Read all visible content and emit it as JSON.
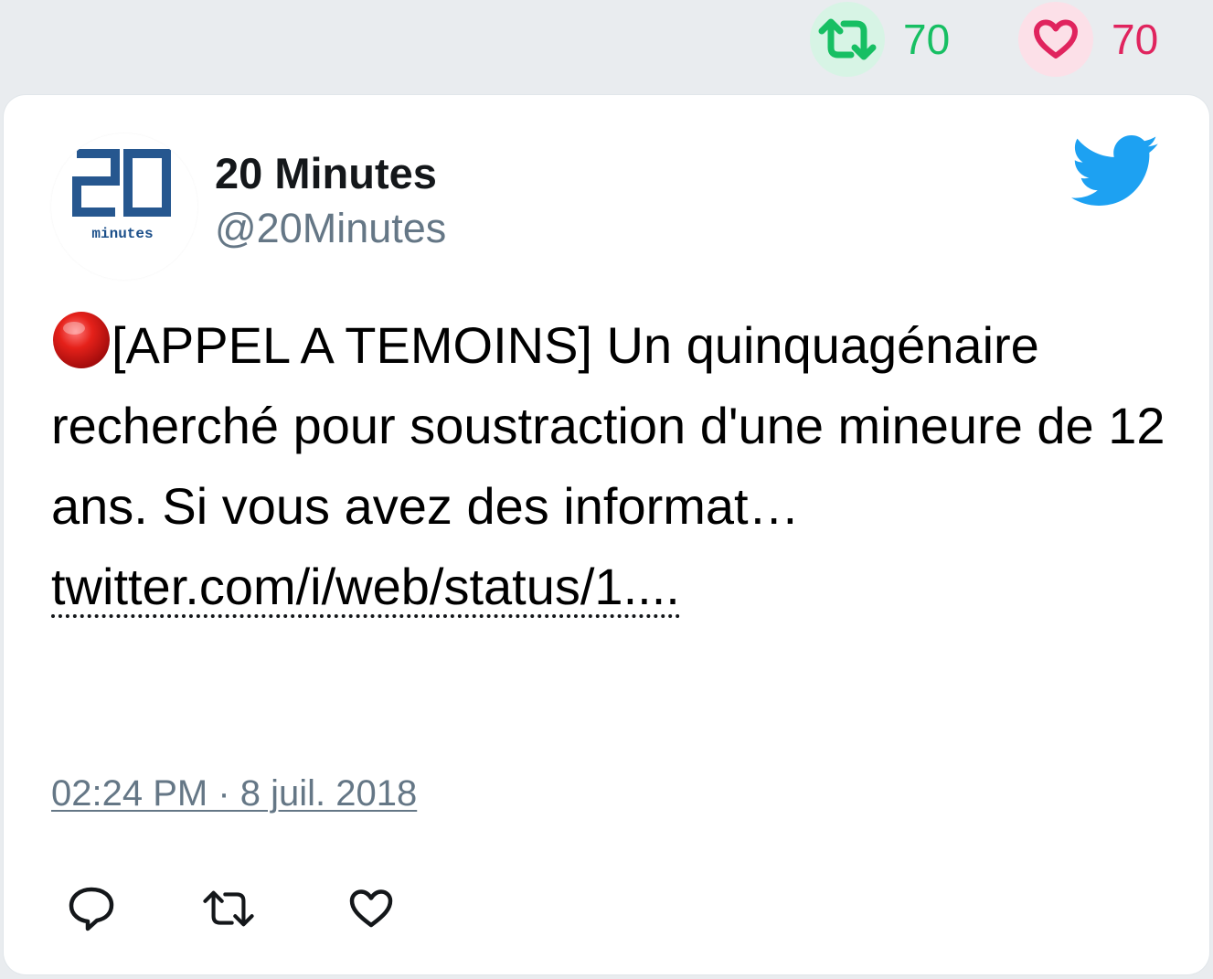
{
  "stats": {
    "retweet_count": "70",
    "like_count": "70",
    "retweet_color": "#17bf63",
    "like_color": "#e0245e",
    "retweet_icon": "retweet-icon",
    "like_icon": "heart-icon"
  },
  "tweet": {
    "author_name": "20 Minutes",
    "author_handle": "@20Minutes",
    "avatar_logo": {
      "digits": "20",
      "caption": "minutes",
      "color": "#1b4f8a"
    },
    "status_emoji": "red-circle",
    "text": "[APPEL A TEMOINS] Un quinquagénaire recherché pour soustraction d'une mineure de 12 ans. Si vous avez des informat…",
    "link": "twitter.com/i/web/status/1....",
    "timestamp": "02:24 PM · 8 juil. 2018",
    "brand_icon": "twitter-bird-icon",
    "brand_color": "#1da1f2"
  },
  "actions": {
    "icons": [
      "reply-icon",
      "retweet-icon",
      "like-icon"
    ]
  }
}
